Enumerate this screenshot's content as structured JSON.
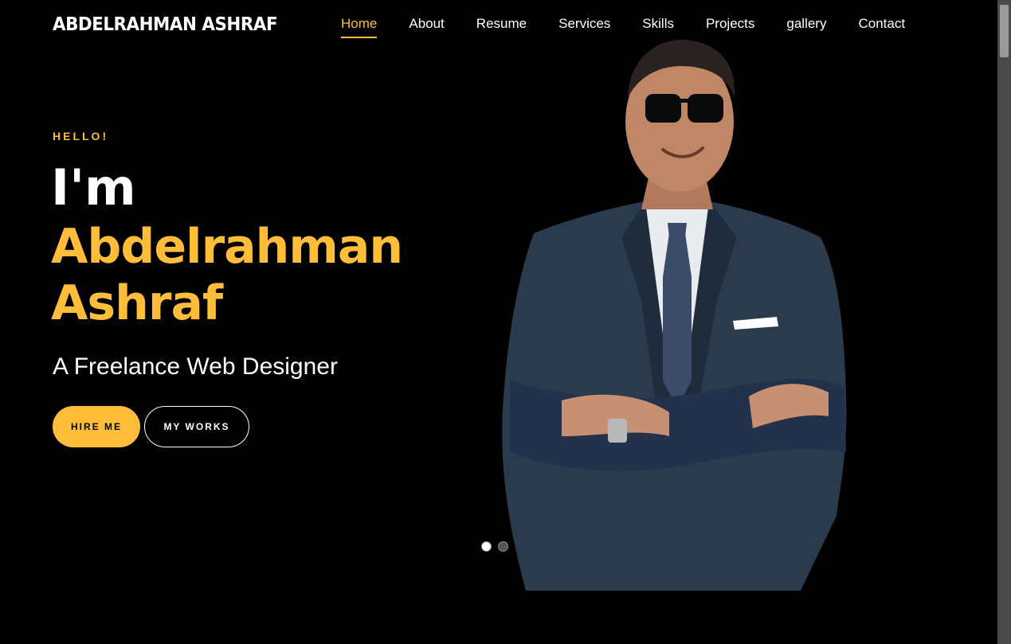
{
  "header": {
    "brand": "ABDELRAHMAN ASHRAF",
    "nav": [
      "Home",
      "About",
      "Resume",
      "Services",
      "Skills",
      "Projects",
      "gallery",
      "Contact"
    ],
    "active": "Home"
  },
  "hero": {
    "greeting": "HELLO!",
    "intro": "I'm",
    "name_line1": "Abdelrahman",
    "name_line2": "Ashraf",
    "subtitle": "A Freelance Web Designer",
    "hire_label": "HIRE ME",
    "works_label": "MY WORKS"
  },
  "slider": {
    "current": 1,
    "total": 2
  },
  "colors": {
    "accent": "#ffbd39",
    "background": "#000000",
    "suit": "#2a3a4c"
  }
}
